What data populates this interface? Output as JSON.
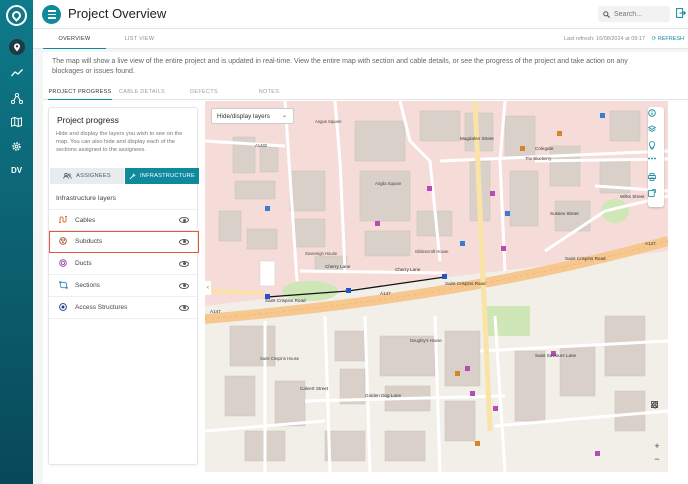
{
  "app": {
    "title": "Project Overview",
    "search_placeholder": "Search..."
  },
  "sidebar": {
    "items": [
      {
        "icon": "location-icon"
      },
      {
        "icon": "trend-icon"
      },
      {
        "icon": "network-icon"
      },
      {
        "icon": "map-icon"
      },
      {
        "icon": "gear-icon"
      }
    ],
    "user_initials": "DV"
  },
  "subtabs": [
    "OVERVIEW",
    "LIST VIEW"
  ],
  "refresh": {
    "last_refresh": "Last refresh: 16/08/2024 at 09:17",
    "label": "REFRESH"
  },
  "description": "The map will show a live view of the entire project and is updated in real-time. View the entire map with section and cable details, or see the progress of the project and take action on any blockages or issues found.",
  "progress_tabs": [
    "PROJECT PROGRESS",
    "CABLE DETAILS",
    "DEFECTS",
    "NOTES"
  ],
  "panel": {
    "title": "Project progress",
    "desc": "Hide and display the layers you wish to see on the map. You can also hide and display each of the sections assigned to the assignees.",
    "toggle": {
      "assignees": "ASSIGNEES",
      "infrastructure": "INFRASTRUCTURE"
    },
    "layers_heading": "Infrastructure layers",
    "layers": [
      {
        "name": "Cables",
        "color": "#e0703a"
      },
      {
        "name": "Subducts",
        "color": "#a0522d"
      },
      {
        "name": "Ducts",
        "color": "#8e44ad"
      },
      {
        "name": "Sections",
        "color": "#2e86c1"
      },
      {
        "name": "Access Structures",
        "color": "#1f3a93"
      }
    ]
  },
  "map": {
    "select_label": "Hide/display layers",
    "labels": {
      "a1482": "A1482",
      "angus_square": "Angus Square",
      "cheryy_lane_1": "Cherry Lane",
      "cherry_lane_2": "Cherry Lane",
      "saint_crispins_road_1": "Saint Crispins Road",
      "saint_crispins_road_2": "Saint Crispins Road",
      "saint_crispins_road_3": "Saint Crispins Road",
      "a147_1": "A147",
      "a147_2": "A147",
      "a147_3": "A147",
      "golden_dog_lane": "Golden Dog Lane",
      "coslany_street": "Coslany Street",
      "colegate": "Colegate",
      "the_blueberry": "The Blueberry",
      "oak_street": "Oak Street",
      "magdalen_street": "Magdalen Street",
      "anglia_square_lbl": "Anglia Square",
      "sovereign_house": "Sovereign House",
      "golden_house": "Gildencroft House",
      "saint_crispins_house": "Saint Crispins House",
      "doughtys_house": "Doughty's House",
      "saint_saviours_lane": "Saint Saviours Lane",
      "calvert_street": "Calvert Street",
      "wilks_street": "Wilks Street",
      "cherry_lane_row": "Cherry Lane",
      "sussex_street": "Sussex Street"
    }
  },
  "colors": {
    "accent": "#0f8a9c",
    "highlight": "#e05a3f"
  }
}
